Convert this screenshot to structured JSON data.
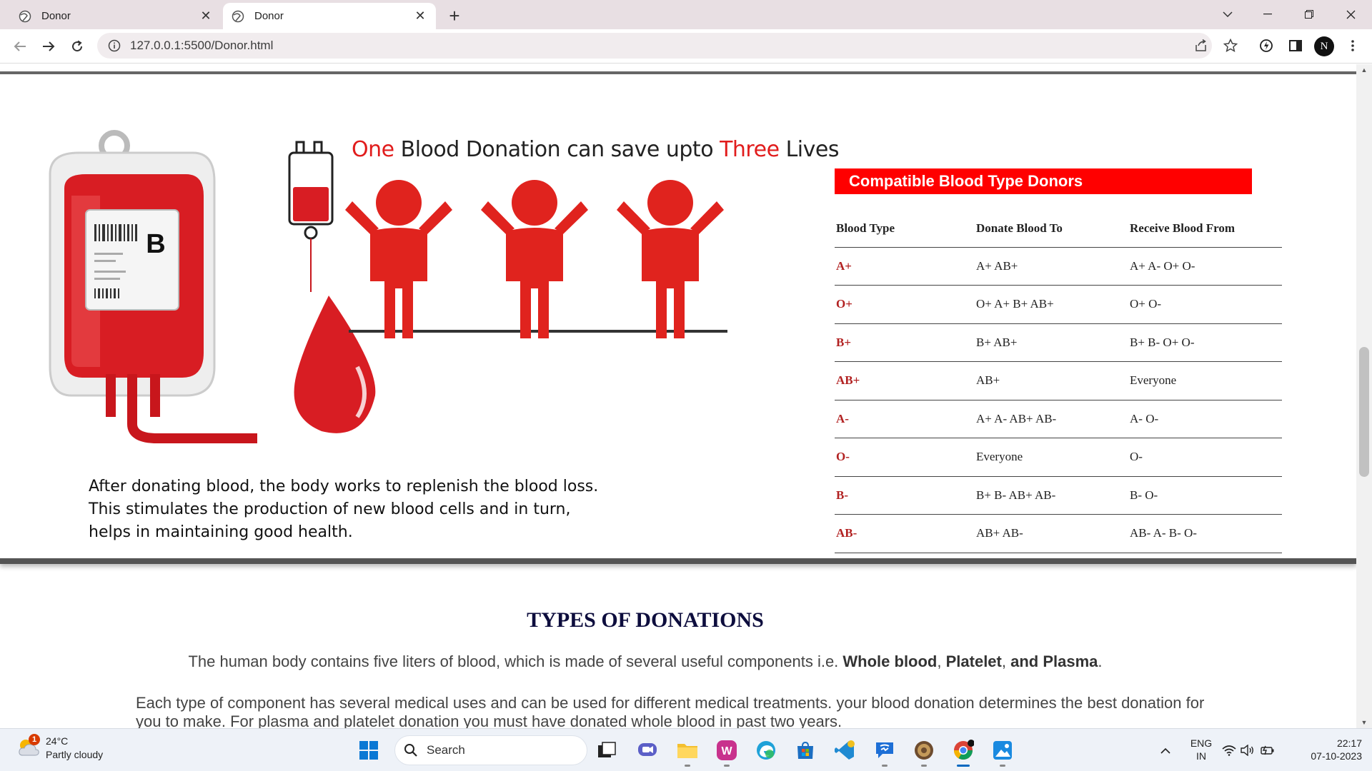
{
  "browser": {
    "tabs": [
      {
        "title": "Donor",
        "active": false
      },
      {
        "title": "Donor",
        "active": true
      }
    ],
    "url": "127.0.0.1:5500/Donor.html"
  },
  "hero": {
    "slogan_prefix": "One",
    "slogan_middle": " Blood Donation can save upto ",
    "slogan_highlight": "Three",
    "slogan_suffix": " Lives",
    "bag_label": "B",
    "after_text": [
      "After donating blood, the body works to replenish the blood loss.",
      "This stimulates the production of new blood cells and in turn,",
      "helps in maintaining good health."
    ]
  },
  "compat": {
    "title": "Compatible Blood Type Donors",
    "headers": [
      "Blood Type",
      "Donate Blood To",
      "Receive Blood From"
    ],
    "rows": [
      [
        "A+",
        "A+ AB+",
        "A+ A- O+ O-"
      ],
      [
        "O+",
        "O+ A+ B+ AB+",
        "O+ O-"
      ],
      [
        "B+",
        "B+ AB+",
        "B+ B- O+ O-"
      ],
      [
        "AB+",
        "AB+",
        "Everyone"
      ],
      [
        "A-",
        "A+ A- AB+ AB-",
        "A- O-"
      ],
      [
        "O-",
        "Everyone",
        "O-"
      ],
      [
        "B-",
        "B+ B- AB+ AB-",
        "B- O-"
      ],
      [
        "AB-",
        "AB+ AB-",
        "AB- A- B- O-"
      ]
    ]
  },
  "types": {
    "heading": "TYPES OF DONATIONS",
    "p1_text": "The human body contains five liters of blood, which is made of several useful components i.e. ",
    "p1_bold1": "Whole blood",
    "p1_sep1": ", ",
    "p1_bold2": "Platelet",
    "p1_sep2": ", ",
    "p1_bold3": "and Plasma",
    "p1_end": ".",
    "p2": "Each type of component has several medical uses and can be used for different medical treatments. your blood donation determines the best donation for you to make. For plasma and platelet donation you must have donated whole blood in past two years."
  },
  "taskbar": {
    "weather_temp": "24°C",
    "weather_desc": "Partly cloudy",
    "weather_badge": "1",
    "search_label": "Search",
    "lang_line1": "ENG",
    "lang_line2": "IN",
    "time": "22:17",
    "date": "07-10-2023"
  },
  "colors": {
    "accent_red": "#ff0000",
    "type_red": "#b22222",
    "heading_navy": "#0d0d3d"
  }
}
